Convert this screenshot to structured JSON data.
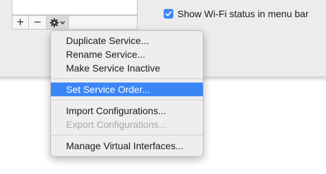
{
  "window": {
    "list_controls": {
      "add_label": "+",
      "remove_label": "−"
    },
    "show_wifi_status": {
      "label": "Show Wi-Fi status in menu bar",
      "checked": true
    }
  },
  "menu": {
    "items": [
      {
        "label": "Duplicate Service..."
      },
      {
        "label": "Rename Service..."
      },
      {
        "label": "Make Service Inactive"
      },
      {
        "label": "Set Service Order...",
        "highlighted": true
      },
      {
        "label": "Import Configurations..."
      },
      {
        "label": "Export Configurations...",
        "disabled": true
      },
      {
        "label": "Manage Virtual Interfaces..."
      }
    ]
  },
  "colors": {
    "accent": "#3b86f7",
    "disabled_text": "#a8a8a8"
  }
}
